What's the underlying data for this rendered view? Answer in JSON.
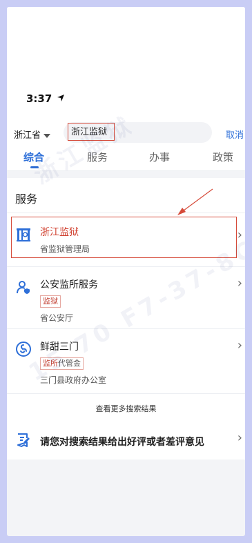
{
  "status": {
    "time": "3:37"
  },
  "search": {
    "province": "浙江省",
    "query": "浙江监狱",
    "cancel": "取消"
  },
  "tabs": [
    {
      "label": "综合"
    },
    {
      "label": "服务"
    },
    {
      "label": "办事"
    },
    {
      "label": "政策"
    }
  ],
  "services": {
    "title": "服务",
    "items": [
      {
        "title": "浙江监狱",
        "subtitle": "省监狱管理局",
        "icon": "prison-icon"
      },
      {
        "title": "公安监所服务",
        "tag": "监狱",
        "subtitle": "省公安厅",
        "icon": "user-shield-icon"
      },
      {
        "title": "鲜甜三门",
        "tag_highlight": "监所",
        "tag_rest": "代管金",
        "subtitle": "三门县政府办公室",
        "icon": "swirl-icon"
      }
    ],
    "more": "查看更多搜索结果"
  },
  "feedback": {
    "title": "请您对搜索结果给出好评或者差评意见",
    "icon": "edit-note-icon"
  },
  "colors": {
    "accent": "#2e6fd8",
    "highlight": "#d64b3a"
  }
}
